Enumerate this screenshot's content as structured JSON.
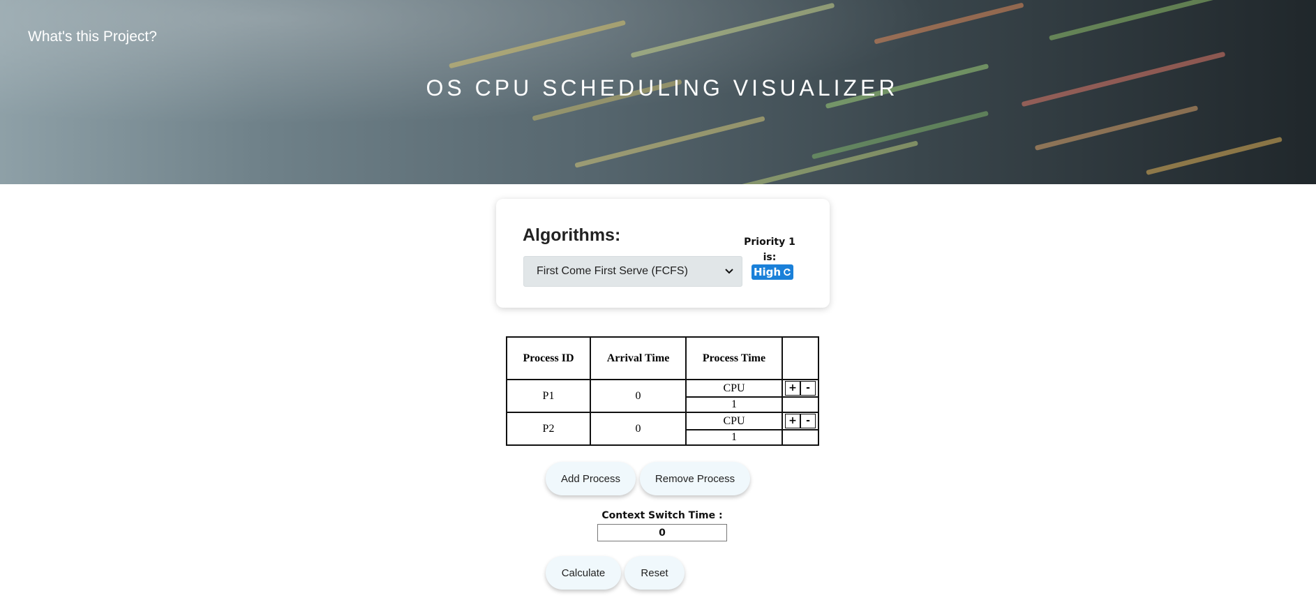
{
  "header": {
    "about_link": "What's this Project?",
    "title": "OS CPU SCHEDULING VISUALIZER"
  },
  "algorithms": {
    "heading": "Algorithms:",
    "selected": "First Come First Serve (FCFS)",
    "priority_label": "Priority 1 is:",
    "priority_value": "High"
  },
  "table": {
    "headers": [
      "Process ID",
      "Arrival Time",
      "Process Time"
    ],
    "rows": [
      {
        "id": "P1",
        "arrival": "0",
        "burst_type": "CPU",
        "burst_value": "1",
        "plus": "+",
        "minus": "-"
      },
      {
        "id": "P2",
        "arrival": "0",
        "burst_type": "CPU",
        "burst_value": "1",
        "plus": "+",
        "minus": "-"
      }
    ]
  },
  "actions": {
    "add_process": "Add Process",
    "remove_process": "Remove Process",
    "calculate": "Calculate",
    "reset": "Reset"
  },
  "context_switch": {
    "label": "Context Switch Time :",
    "value": "0"
  },
  "colors": {
    "accent": "#1a80d9",
    "button_bg": "#f0f8fc"
  }
}
